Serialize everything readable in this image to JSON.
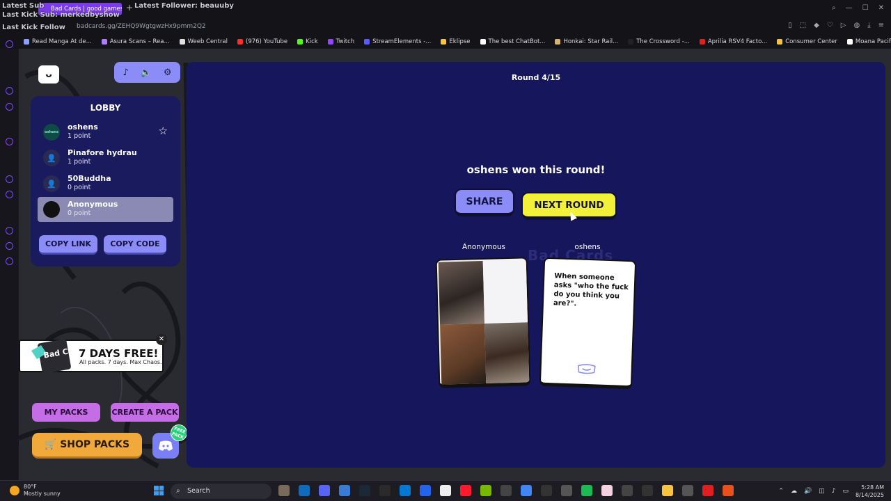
{
  "overlay": {
    "latest_sub": "Latest Sub",
    "latest_follower": "Latest Follower: beauuby",
    "latest_kick_sub": "Last Kick Sub: merkedbyshow",
    "last_kick_follow": "Last Kick Follow"
  },
  "browser": {
    "tab_title": "Bad Cards | good games",
    "url": "badcards.gg/ZEHQ9WgtgwzHx9pmm2Q2",
    "bookmarks": [
      {
        "label": "Read Manga At de...",
        "color": "#8aa0ff"
      },
      {
        "label": "Asura Scans – Rea...",
        "color": "#b07cff"
      },
      {
        "label": "Weeb Central",
        "color": "#e0e0e0"
      },
      {
        "label": "(976) YouTube",
        "color": "#ff2d2d"
      },
      {
        "label": "Kick",
        "color": "#53fc18"
      },
      {
        "label": "Twitch",
        "color": "#9146ff"
      },
      {
        "label": "StreamElements -...",
        "color": "#5b5bff"
      },
      {
        "label": "Eklipse",
        "color": "#f5c542"
      },
      {
        "label": "The best ChatBot...",
        "color": "#ffffff"
      },
      {
        "label": "Honkai: Star Rail...",
        "color": "#d9b36a"
      },
      {
        "label": "The Crossword -...",
        "color": "#222222"
      },
      {
        "label": "Aprilia RSV4 Facto...",
        "color": "#e02020"
      },
      {
        "label": "Consumer Center",
        "color": "#f5c542"
      },
      {
        "label": "Moana Pacific #I-...",
        "color": "#ffffff"
      }
    ]
  },
  "game": {
    "lobby_title": "LOBBY",
    "players": [
      {
        "name": "oshens",
        "points": "1 point",
        "avatar": "oshens-logo"
      },
      {
        "name": "Pinafore hydrau",
        "points": "1 point",
        "avatar": "user-icon"
      },
      {
        "name": "50Buddha",
        "points": "0 point",
        "avatar": "user-icon"
      },
      {
        "name": "Anonymous",
        "points": "0 point",
        "avatar": "dark-avatar"
      }
    ],
    "copy_link": "COPY LINK",
    "copy_code": "COPY CODE",
    "promo_title": "7 DAYS FREE!",
    "promo_sub": "All packs. 7 days. Max Chaos.",
    "promo_badge": "Bad Cards",
    "my_packs": "MY PACKS",
    "create_pack": "CREATE A PACK",
    "shop_packs": "SHOP PACKS",
    "free_badge": "FREE PACK",
    "round": "Round 4/15",
    "winner_msg": "oshens won this round!",
    "share": "SHARE",
    "next_round": "NEXT ROUND",
    "card_left_label": "Anonymous",
    "card_right_label": "oshens",
    "prompt_text": "When someone asks \"who the fuck do you think you are?\".",
    "watermark": "Bad Cards"
  },
  "taskbar": {
    "temp": "80°F",
    "weather": "Mostly sunny",
    "search": "Search",
    "time": "5:28 AM",
    "date": "8/14/2025"
  },
  "colors": {
    "accent_purple": "#8b8cf7",
    "game_bg": "#16165c",
    "next_yellow": "#f3f03a",
    "shop_orange": "#f2a93b"
  }
}
